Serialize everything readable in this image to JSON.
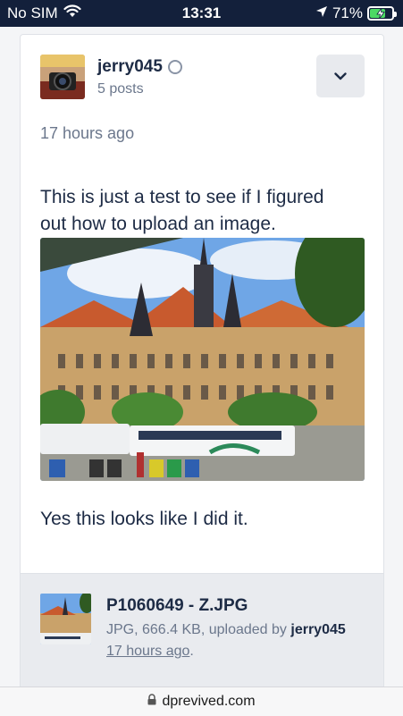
{
  "status_bar": {
    "carrier": "No SIM",
    "time": "13:31",
    "battery_text": "71%",
    "battery_level": 0.71
  },
  "post": {
    "author": "jerry045",
    "post_count": "5 posts",
    "timestamp": "17 hours ago",
    "body_line_1": "This is just a test to see if I figured out how to upload an image.",
    "body_line_2": "Yes this looks like I did it."
  },
  "attachment": {
    "filename": "P1060649 - Z.JPG",
    "meta_prefix": "JPG, 666.4 KB, uploaded by",
    "uploader": "jerry045",
    "time": "17 hours ago",
    "time_suffix": "."
  },
  "browser": {
    "url": "dprevived.com"
  },
  "colors": {
    "status_bar_bg": "#13203b",
    "text_primary": "#1d2b45",
    "text_muted": "#6b778c",
    "attachment_bg": "#e9ebef",
    "battery_fill": "#4cd964"
  }
}
